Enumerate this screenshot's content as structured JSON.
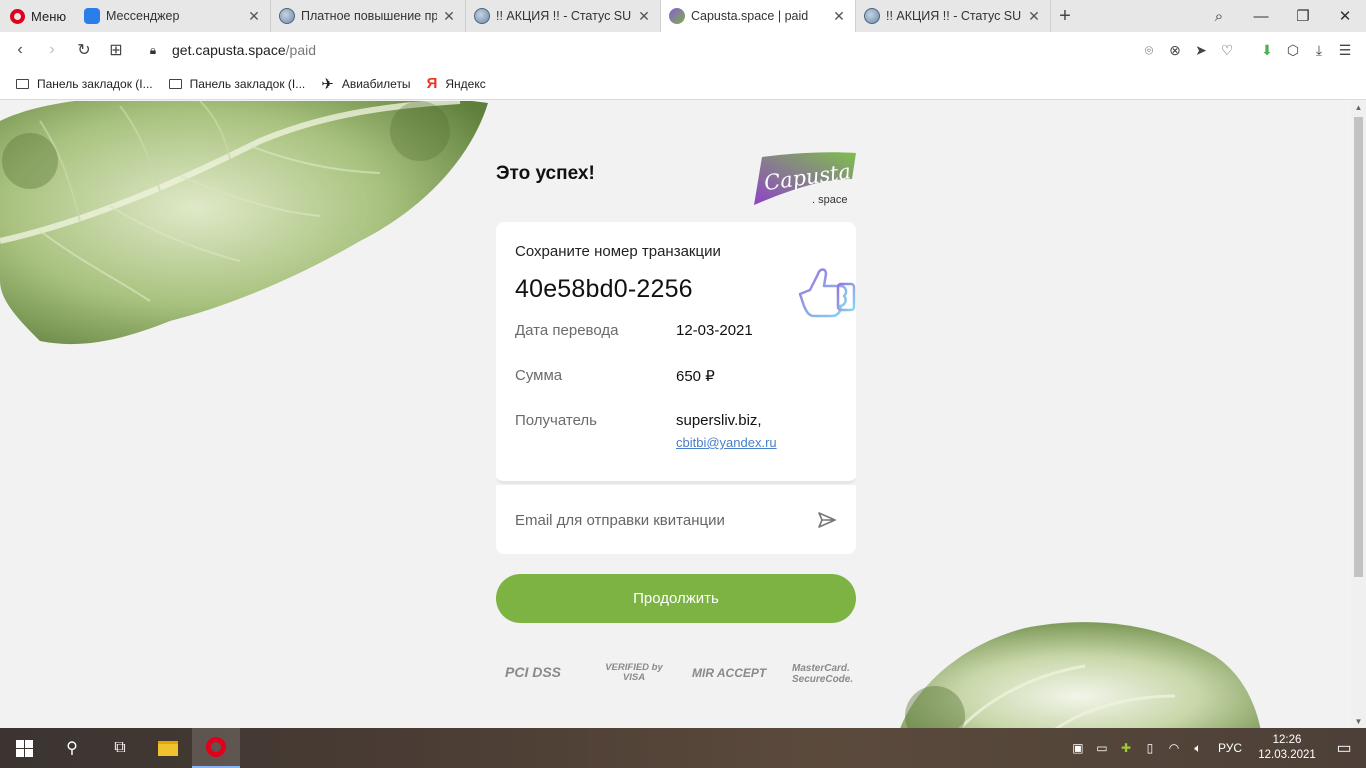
{
  "browser": {
    "menu_label": "Меню",
    "tabs": [
      {
        "title": "Мессенджер",
        "favicon": "messenger-icon"
      },
      {
        "title": "Платное повышение прав",
        "favicon": "globe-icon"
      },
      {
        "title": "!! АКЦИЯ !! - Статус SUPER",
        "favicon": "globe-icon"
      },
      {
        "title": "Capusta.space | paid",
        "favicon": "capusta-icon",
        "active": true
      },
      {
        "title": "!! АКЦИЯ !! - Статус SUPER",
        "favicon": "globe-icon"
      }
    ],
    "url": {
      "host": "get.capusta.space",
      "path": "/paid"
    },
    "bookmarks": [
      {
        "label": "Панель закладок (I...",
        "icon": "folder-icon"
      },
      {
        "label": "Панель закладок (I...",
        "icon": "folder-icon"
      },
      {
        "label": "Авиабилеты",
        "icon": "plane-icon"
      },
      {
        "label": "Яндекс",
        "icon": "yandex-icon"
      }
    ]
  },
  "page": {
    "heading": "Это успех!",
    "logo": {
      "text": "Capusta",
      "sub": ". space"
    },
    "save_label": "Сохраните номер транзакции",
    "transaction_id": "40e58bd0-2256",
    "rows": [
      {
        "label": "Дата перевода",
        "value": "12-03-2021"
      },
      {
        "label": "Сумма",
        "value": "650 ₽"
      },
      {
        "label": "Получатель",
        "value": "supersliv.biz,",
        "link": "cbitbi@yandex.ru"
      }
    ],
    "email_placeholder": "Email для отправки квитанции",
    "continue_label": "Продолжить",
    "badges": [
      "PCI DSS",
      "VERIFIED by VISA",
      "MIR ACCEPT",
      "MasterCard. SecureCode."
    ]
  },
  "taskbar": {
    "lang": "РУС",
    "time": "12:26",
    "date": "12.03.2021"
  },
  "colors": {
    "accent_green": "#7cb342",
    "link": "#4a7fc9",
    "opera_red": "#e0001b"
  }
}
